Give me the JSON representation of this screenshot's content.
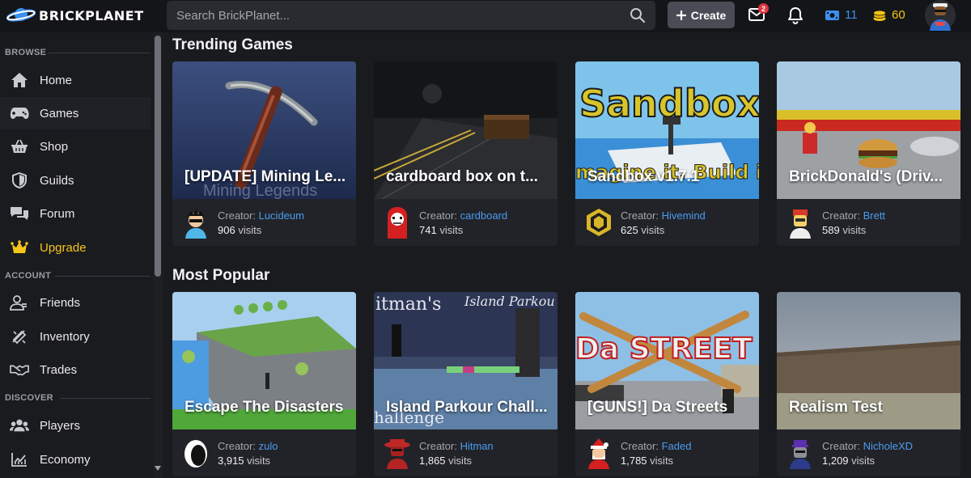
{
  "brand": {
    "name": "BRICKPLANET"
  },
  "search": {
    "placeholder": "Search BrickPlanet..."
  },
  "header": {
    "create_label": "Create",
    "notifications_count": "2",
    "bits": "11",
    "bucks": "60"
  },
  "sidebar": {
    "sections": [
      {
        "label": "BROWSE"
      },
      {
        "label": "ACCOUNT"
      },
      {
        "label": "DISCOVER"
      }
    ],
    "items": [
      {
        "label": "Home",
        "icon": "home-icon"
      },
      {
        "label": "Games",
        "icon": "gamepad-icon"
      },
      {
        "label": "Shop",
        "icon": "basket-icon"
      },
      {
        "label": "Guilds",
        "icon": "shield-icon"
      },
      {
        "label": "Forum",
        "icon": "comments-icon"
      },
      {
        "label": "Upgrade",
        "icon": "crown-icon"
      },
      {
        "label": "Friends",
        "icon": "user-friends-icon"
      },
      {
        "label": "Inventory",
        "icon": "inventory-icon"
      },
      {
        "label": "Trades",
        "icon": "handshake-icon"
      },
      {
        "label": "Players",
        "icon": "users-icon"
      },
      {
        "label": "Economy",
        "icon": "chart-icon"
      }
    ]
  },
  "sections": {
    "trending": {
      "title": "Trending Games",
      "games": [
        {
          "title": "[UPDATE] Mining Le...",
          "creator_prefix": "Creator:",
          "creator": "Lucideum",
          "visits": "906",
          "visits_suffix": "visits"
        },
        {
          "title": "cardboard box on t...",
          "creator_prefix": "Creator:",
          "creator": "cardboard",
          "visits": "741",
          "visits_suffix": "visits"
        },
        {
          "title": "Sandbox v1.7.1",
          "creator_prefix": "Creator:",
          "creator": "Hivemind",
          "visits": "625",
          "visits_suffix": "visits"
        },
        {
          "title": "BrickDonald's (Driv...",
          "creator_prefix": "Creator:",
          "creator": "Brett",
          "visits": "589",
          "visits_suffix": "visits"
        }
      ]
    },
    "popular": {
      "title": "Most Popular",
      "games": [
        {
          "title": "Escape The Disasters",
          "creator_prefix": "Creator:",
          "creator": "zulo",
          "visits": "3,915",
          "visits_suffix": "visits"
        },
        {
          "title": "Island Parkour Chall...",
          "creator_prefix": "Creator:",
          "creator": "Hitman",
          "visits": "1,865",
          "visits_suffix": "visits"
        },
        {
          "title": "[GUNS!] Da Streets",
          "creator_prefix": "Creator:",
          "creator": "Faded",
          "visits": "1,785",
          "visits_suffix": "visits"
        },
        {
          "title": "Realism Test",
          "creator_prefix": "Creator:",
          "creator": "NicholeXD",
          "visits": "1,209",
          "visits_suffix": "visits"
        }
      ]
    }
  },
  "thumbnail_text": {
    "mining_subtitle": "Mining Legends",
    "sandbox_banner": "Sandbox",
    "sandbox_sub": "magine it. Build i",
    "parkour_left": "itman's",
    "parkour_right": "Island Parkou",
    "parkour_bottom": "hallenge",
    "streets_banner": "Da STREET"
  },
  "colors": {
    "accent_blue": "#4a9cf0",
    "upgrade_gold": "#f5c518",
    "badge_red": "#e03340"
  }
}
